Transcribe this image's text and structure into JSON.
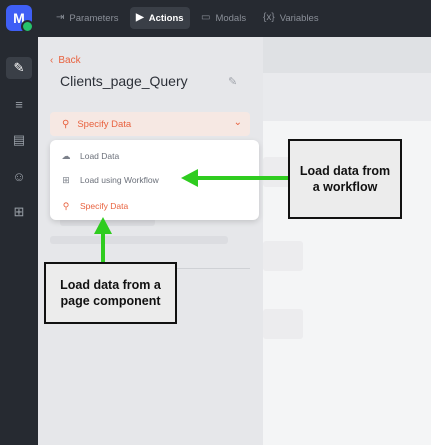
{
  "logo": {
    "letter": "M"
  },
  "topnav": {
    "tabs": [
      {
        "label": "Parameters",
        "icon": "⇥"
      },
      {
        "label": "Actions",
        "icon": "▶"
      },
      {
        "label": "Modals",
        "icon": "▭"
      },
      {
        "label": "Variables",
        "icon": "{x}"
      }
    ]
  },
  "rail": {
    "items": [
      {
        "name": "design-tool-icon",
        "glyph": "✎"
      },
      {
        "name": "database-icon",
        "glyph": "≡"
      },
      {
        "name": "layout-icon",
        "glyph": "▤"
      },
      {
        "name": "users-icon",
        "glyph": "☺"
      },
      {
        "name": "workflow-icon",
        "glyph": "⊞"
      }
    ]
  },
  "panel": {
    "back_label": "Back",
    "title": "Clients_page_Query",
    "dropdown_value": "Specify Data",
    "menu": [
      {
        "label": "Load Data",
        "icon": "☁"
      },
      {
        "label": "Load using Workflow",
        "icon": "⊞"
      },
      {
        "label": "Specify Data",
        "icon": "⚲"
      }
    ]
  },
  "annotations": {
    "workflow_note": "Load data from a workflow",
    "component_note": "Load data from a page component"
  },
  "colors": {
    "accent": "#e8623f",
    "brand": "#3f5ff5",
    "arrow": "#2fcc1f"
  }
}
